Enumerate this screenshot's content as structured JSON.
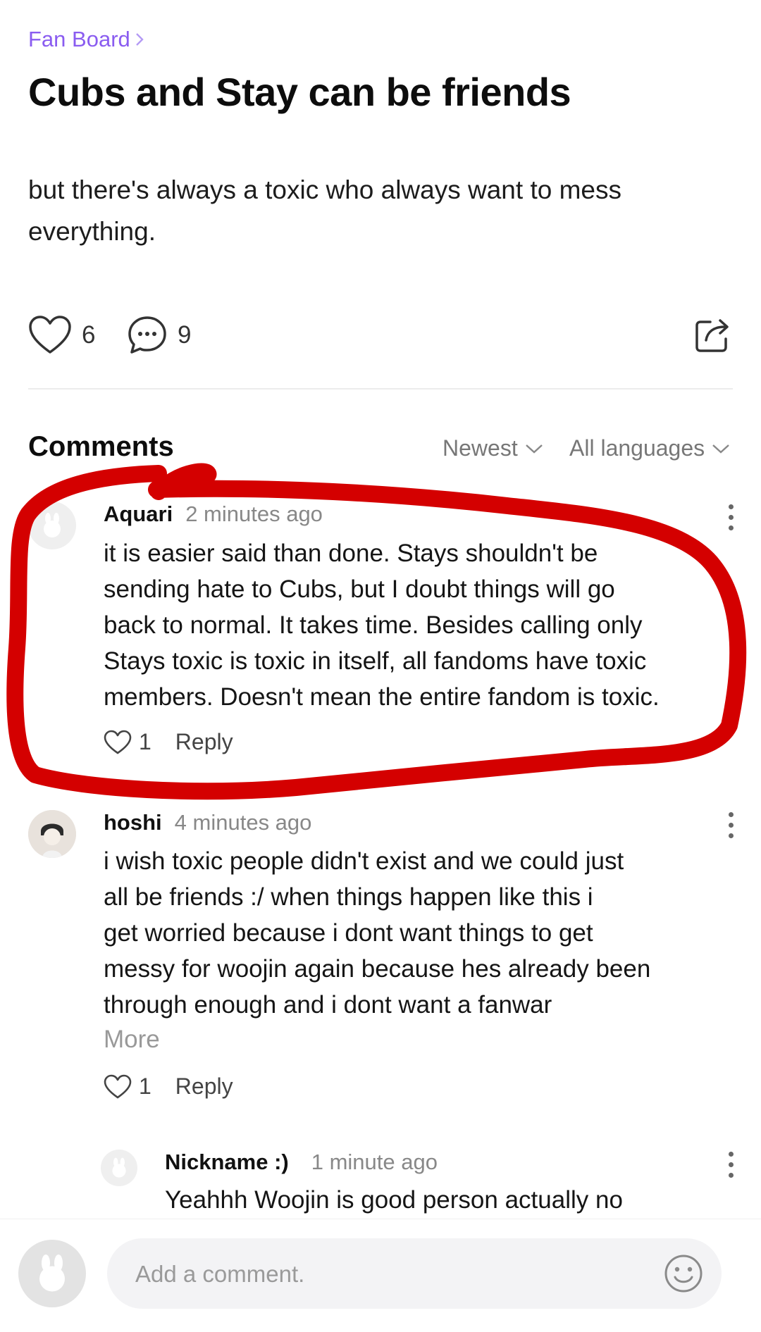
{
  "breadcrumb": {
    "label": "Fan Board"
  },
  "post": {
    "title": "Cubs and Stay can be friends",
    "body": "but there's always a toxic who always want to mess everything.",
    "likes": "6",
    "comments": "9"
  },
  "comments_section": {
    "title": "Comments",
    "sort_label": "Newest",
    "language_label": "All languages"
  },
  "comments": [
    {
      "author": "Aquari",
      "time": "2 minutes ago",
      "lines": [
        "it is easier said than done. Stays shouldn't be",
        "sending hate to Cubs, but I doubt things will go",
        "back to normal. It takes time. Besides calling only",
        "Stays toxic is toxic in itself, all fandoms have toxic",
        "members. Doesn't mean the entire fandom is toxic."
      ],
      "likes": "1",
      "reply_label": "Reply"
    },
    {
      "author": "hoshi",
      "time": "4 minutes ago",
      "lines": [
        "i wish toxic people didn't exist and we could just",
        "all be friends :/ when things happen like this i",
        "get worried because i dont want things to get",
        "messy for woojin again because hes already been",
        "through enough and i dont want a fanwar"
      ],
      "more_label": "More",
      "likes": "1",
      "reply_label": "Reply"
    },
    {
      "author": "Nickname :)",
      "time": "1 minute ago",
      "lines": [
        "Yeahhh Woojin is good person actually no"
      ]
    }
  ],
  "composer": {
    "placeholder": "Add a comment."
  },
  "annotation": {
    "color": "#d40000"
  },
  "colors": {
    "accent": "#8a5cf0"
  }
}
